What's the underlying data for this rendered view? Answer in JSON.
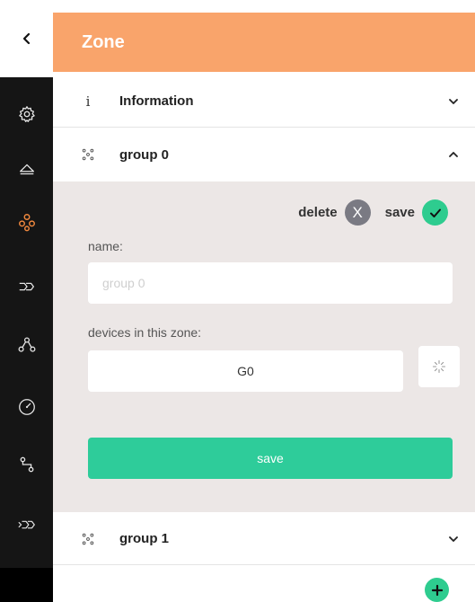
{
  "header": {
    "title": "Zone"
  },
  "sidebar": {
    "back_icon": "chevron-left-icon",
    "items": [
      {
        "icon": "gear-icon",
        "active": false
      },
      {
        "icon": "triangle-icon",
        "active": false
      },
      {
        "icon": "group-icon",
        "active": true
      },
      {
        "icon": "double-arrow-icon",
        "active": false
      },
      {
        "icon": "network-icon",
        "active": false
      },
      {
        "icon": "gauge-icon",
        "active": false
      },
      {
        "icon": "route-icon",
        "active": false
      },
      {
        "icon": "triple-arrow-icon",
        "active": false
      }
    ]
  },
  "sections": {
    "information": {
      "icon_glyph": "i",
      "label": "Information"
    },
    "group0": {
      "label": "group 0",
      "delete_label": "delete",
      "delete_glyph": "X",
      "save_label": "save",
      "name_label": "name:",
      "name_placeholder": "group 0",
      "devices_label": "devices in this zone:",
      "devices_value": "G0",
      "save_button_label": "save"
    },
    "group1": {
      "label": "group 1"
    }
  },
  "colors": {
    "header": "#f9a46b",
    "accent_green": "#2ecc8f",
    "active_icon": "#f0883e",
    "panel_bg": "#ece7e6",
    "rail_bg": "#151515"
  }
}
